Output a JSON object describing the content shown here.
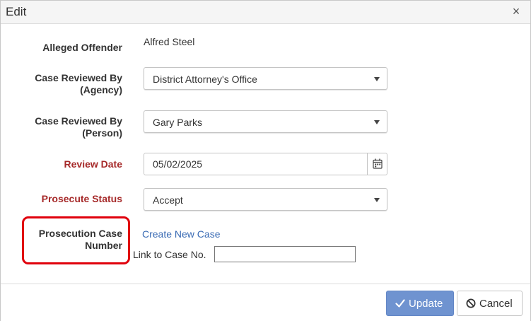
{
  "dialog": {
    "title": "Edit",
    "close_glyph": "×"
  },
  "form": {
    "alleged_offender": {
      "label": "Alleged Offender",
      "value": "Alfred Steel"
    },
    "reviewed_by_agency": {
      "label_line1": "Case Reviewed By",
      "label_line2": "(Agency)",
      "value": "District Attorney's Office"
    },
    "reviewed_by_person": {
      "label_line1": "Case Reviewed By",
      "label_line2": "(Person)",
      "value": "Gary Parks"
    },
    "review_date": {
      "label": "Review Date",
      "value": "05/02/2025",
      "icon": "calendar-icon"
    },
    "prosecute_status": {
      "label": "Prosecute Status",
      "value": "Accept"
    },
    "prosecution_case_number": {
      "label_line1": "Prosecution Case",
      "label_line2": "Number",
      "create_link": "Create New Case",
      "link_to_label": "Link to Case No.",
      "link_to_value": ""
    }
  },
  "footer": {
    "update_label": "Update",
    "cancel_label": "Cancel"
  },
  "colors": {
    "required_label": "#a62a2a",
    "link": "#3a6bb4",
    "primary_button": "#6f93d0",
    "highlight": "#e0000c"
  }
}
